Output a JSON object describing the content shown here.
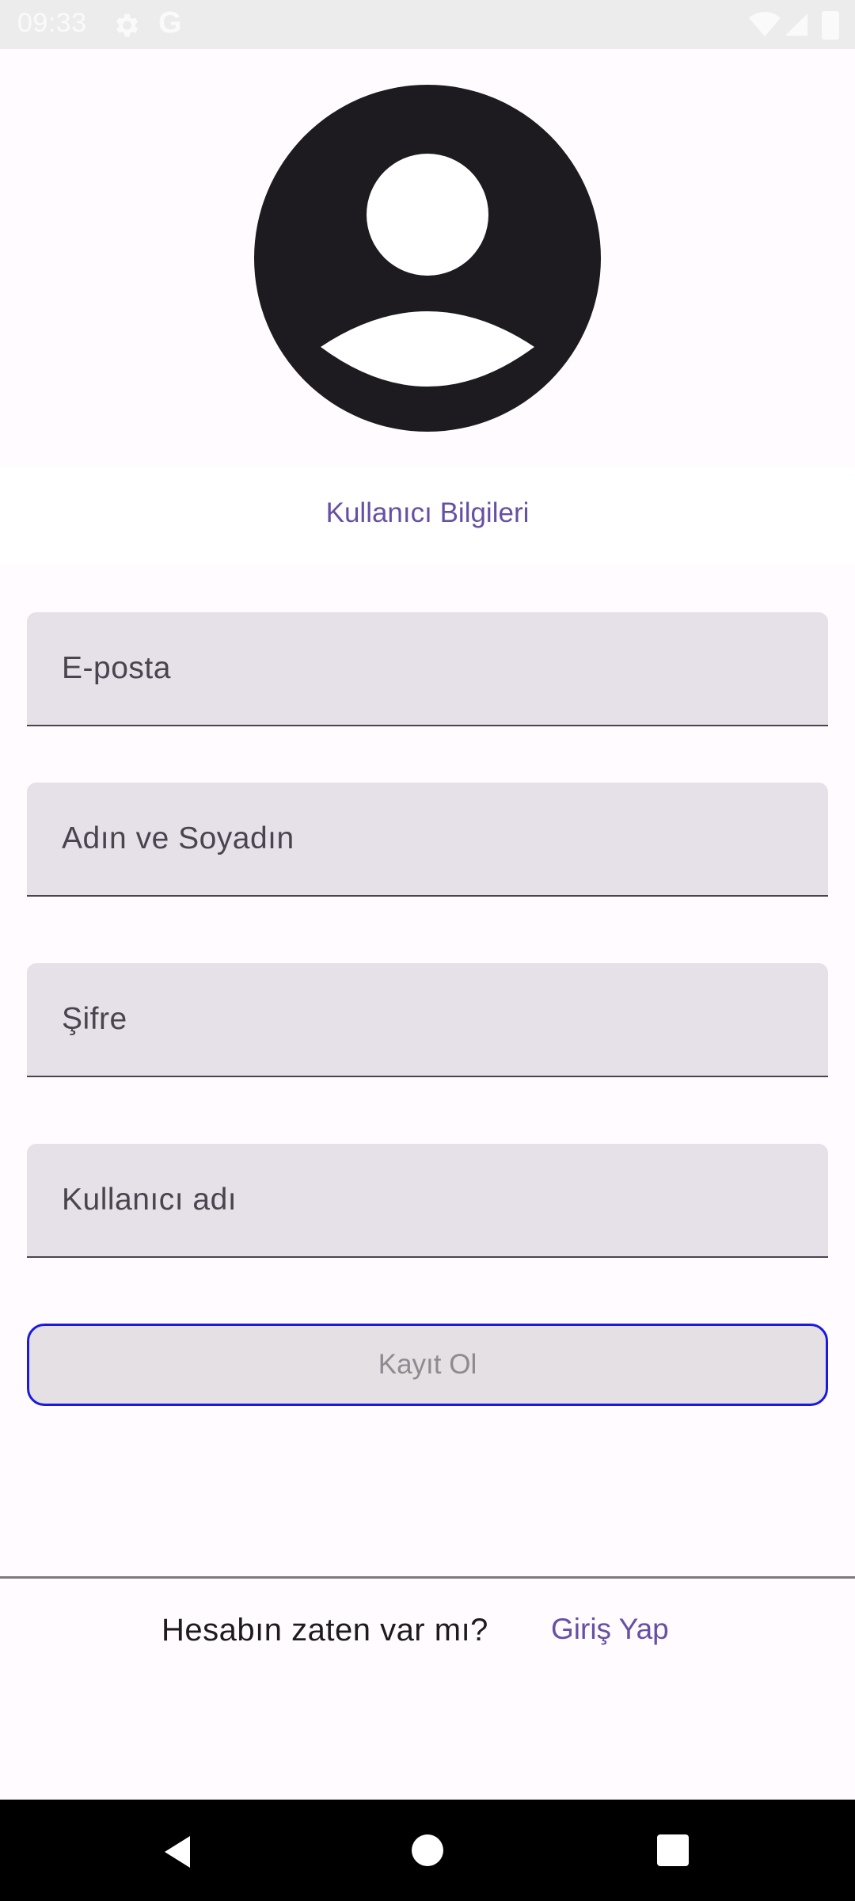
{
  "status_bar": {
    "time": "09:33",
    "g_logo": "G"
  },
  "avatar": {
    "icon": "account-circle-icon"
  },
  "section": {
    "title": "Kullanıcı Bilgileri"
  },
  "form": {
    "email_placeholder": "E-posta",
    "name_placeholder": "Adın ve Soyadın",
    "password_placeholder": "Şifre",
    "username_placeholder": "Kullanıcı adı",
    "register_label": "Kayıt Ol"
  },
  "footer": {
    "prompt": "Hesabın zaten var mı?",
    "login_label": "Giriş Yap"
  },
  "colors": {
    "accent": "#6750a4",
    "field_bg": "#e6e0e9",
    "button_border": "#1a1adf"
  }
}
